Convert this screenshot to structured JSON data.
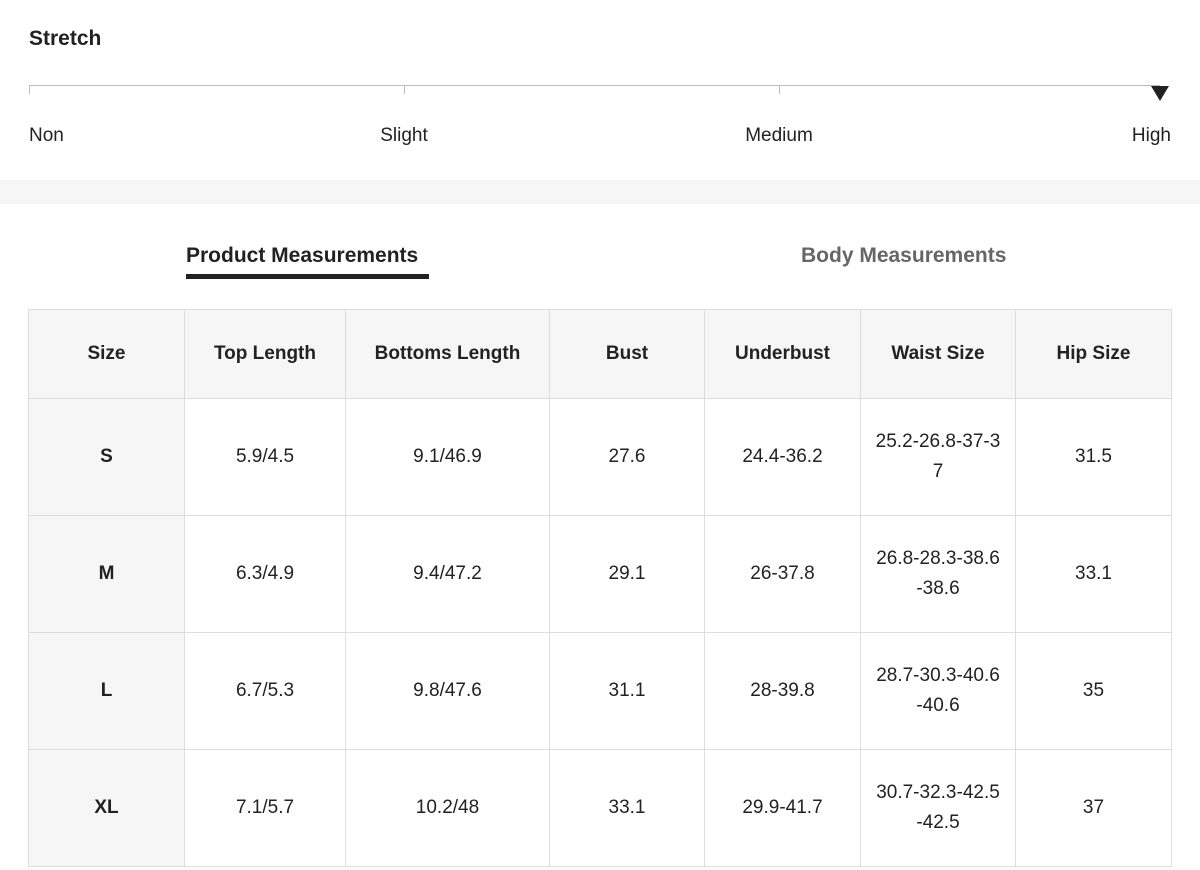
{
  "stretch": {
    "title": "Stretch",
    "levels": [
      "Non",
      "Slight",
      "Medium",
      "High"
    ],
    "selected": "High"
  },
  "tabs": [
    {
      "label": "Product Measurements",
      "active": true
    },
    {
      "label": "Body Measurements",
      "active": false
    }
  ],
  "table": {
    "headers": [
      "Size",
      "Top Length",
      "Bottoms Length",
      "Bust",
      "Underbust",
      "Waist Size",
      "Hip Size"
    ],
    "rows": [
      [
        "S",
        "5.9/4.5",
        "9.1/46.9",
        "27.6",
        "24.4-36.2",
        "25.2-26.8-37-37",
        "31.5"
      ],
      [
        "M",
        "6.3/4.9",
        "9.4/47.2",
        "29.1",
        "26-37.8",
        "26.8-28.3-38.6-38.6",
        "33.1"
      ],
      [
        "L",
        "6.7/5.3",
        "9.8/47.6",
        "31.1",
        "28-39.8",
        "28.7-30.3-40.6-40.6",
        "35"
      ],
      [
        "XL",
        "7.1/5.7",
        "10.2/48",
        "33.1",
        "29.9-41.7",
        "30.7-32.3-42.5-42.5",
        "37"
      ]
    ]
  },
  "colors": {
    "text": "#222222",
    "muted_tab": "#666666",
    "header_bg": "#f6f6f6",
    "border": "#dddddd"
  }
}
